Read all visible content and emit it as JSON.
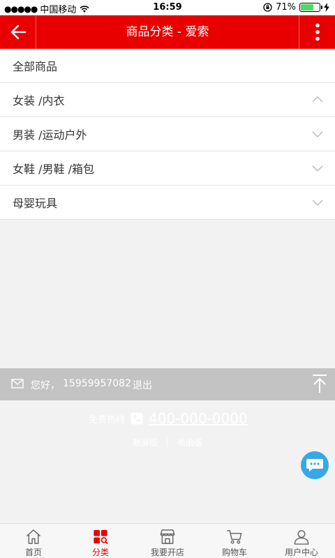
{
  "status": {
    "carrier": "中国移动",
    "time": "16:59",
    "battery": "71%",
    "battery_level": 0.71
  },
  "header": {
    "title": "商品分类 - 爱索"
  },
  "categories": [
    {
      "label": "全部商品",
      "expandable": false
    },
    {
      "label": "女装 /内衣",
      "expandable": true,
      "expanded": true
    },
    {
      "label": "男装 /运动户外",
      "expandable": true,
      "expanded": false
    },
    {
      "label": "女鞋 /男鞋 /箱包",
      "expandable": true,
      "expanded": false
    },
    {
      "label": "母婴玩具",
      "expandable": true,
      "expanded": false
    }
  ],
  "userbar": {
    "greeting": "您好，",
    "phone": "15959957082",
    "logout": "退出"
  },
  "footer": {
    "hotline_label": "免费热线",
    "hotline_number": "400-000-0000",
    "link_1": "触屏版",
    "separator": "|",
    "link_2": "电脑版"
  },
  "tabs": [
    {
      "label": "首页",
      "icon": "home-icon"
    },
    {
      "label": "分类",
      "icon": "category-icon",
      "active": true
    },
    {
      "label": "我要开店",
      "icon": "store-icon"
    },
    {
      "label": "购物车",
      "icon": "cart-icon"
    },
    {
      "label": "用户中心",
      "icon": "user-icon"
    }
  ],
  "colors": {
    "brand": "#e80000",
    "chat": "#36a8e8"
  }
}
